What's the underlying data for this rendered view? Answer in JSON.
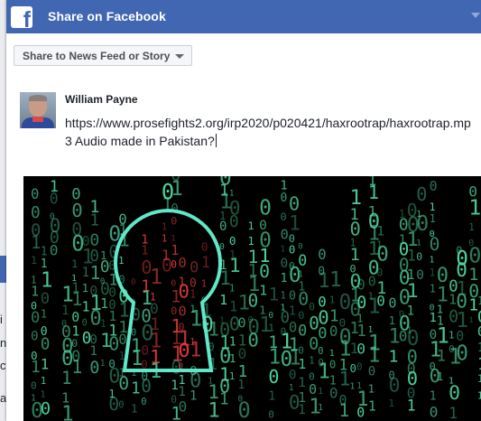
{
  "background_page": {
    "fragments": [
      "i",
      "n",
      "ct",
      "a"
    ]
  },
  "header": {
    "logo_letter": "f",
    "title": "Share on Facebook",
    "chevron_icon": "chevron-down-icon",
    "color": "#4267b2"
  },
  "share_target": {
    "selected": "Share to News Feed or Story",
    "caret_icon": "caret-down-icon"
  },
  "composer": {
    "user_name": "William Payne",
    "text": "https://www.prosefights2.org/irp2020/p020421/haxrootrap/haxrootrap.mp3   Audio made in Pakistan?"
  },
  "link_preview": {
    "image": "keyhole-binary-matrix-image",
    "colors": {
      "digits": "#4fd7a0",
      "keyhole": "#62e6c8",
      "red_digits": "#e23b3b"
    }
  }
}
